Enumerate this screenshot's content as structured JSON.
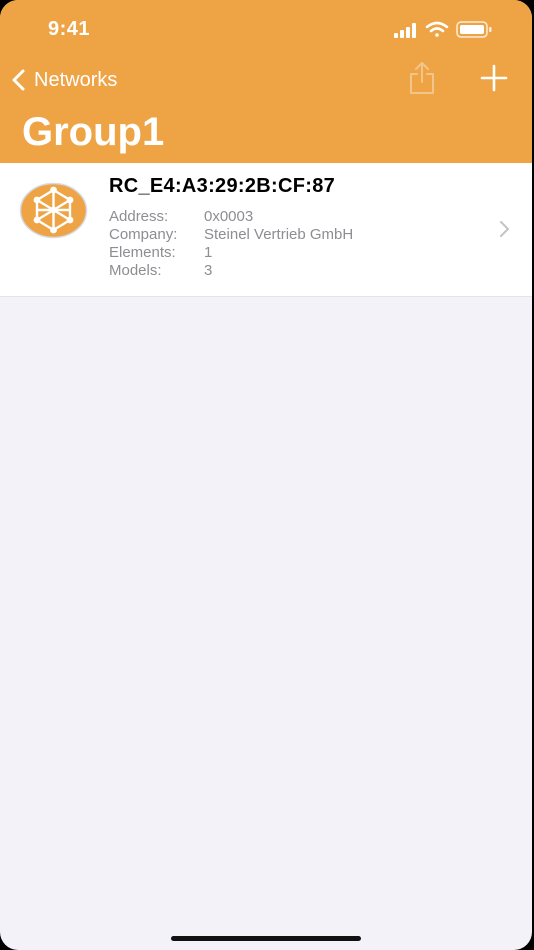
{
  "status_bar": {
    "time": "9:41"
  },
  "nav": {
    "back_label": "Networks",
    "title": "Group1"
  },
  "colors": {
    "accent": "#eea445",
    "background": "#f3f2f8",
    "secondary_text": "#8d8d92"
  },
  "icons": {
    "back": "chevron-left-icon",
    "share": "share-icon",
    "add": "plus-icon",
    "node": "mesh-node-icon",
    "disclosure": "chevron-right-icon"
  },
  "nodes": [
    {
      "name": "RC_E4:A3:29:2B:CF:87",
      "details": [
        {
          "label": "Address:",
          "value": "0x0003"
        },
        {
          "label": "Company:",
          "value": "Steinel Vertrieb GmbH"
        },
        {
          "label": "Elements:",
          "value": "1"
        },
        {
          "label": "Models:",
          "value": "3"
        }
      ]
    }
  ]
}
